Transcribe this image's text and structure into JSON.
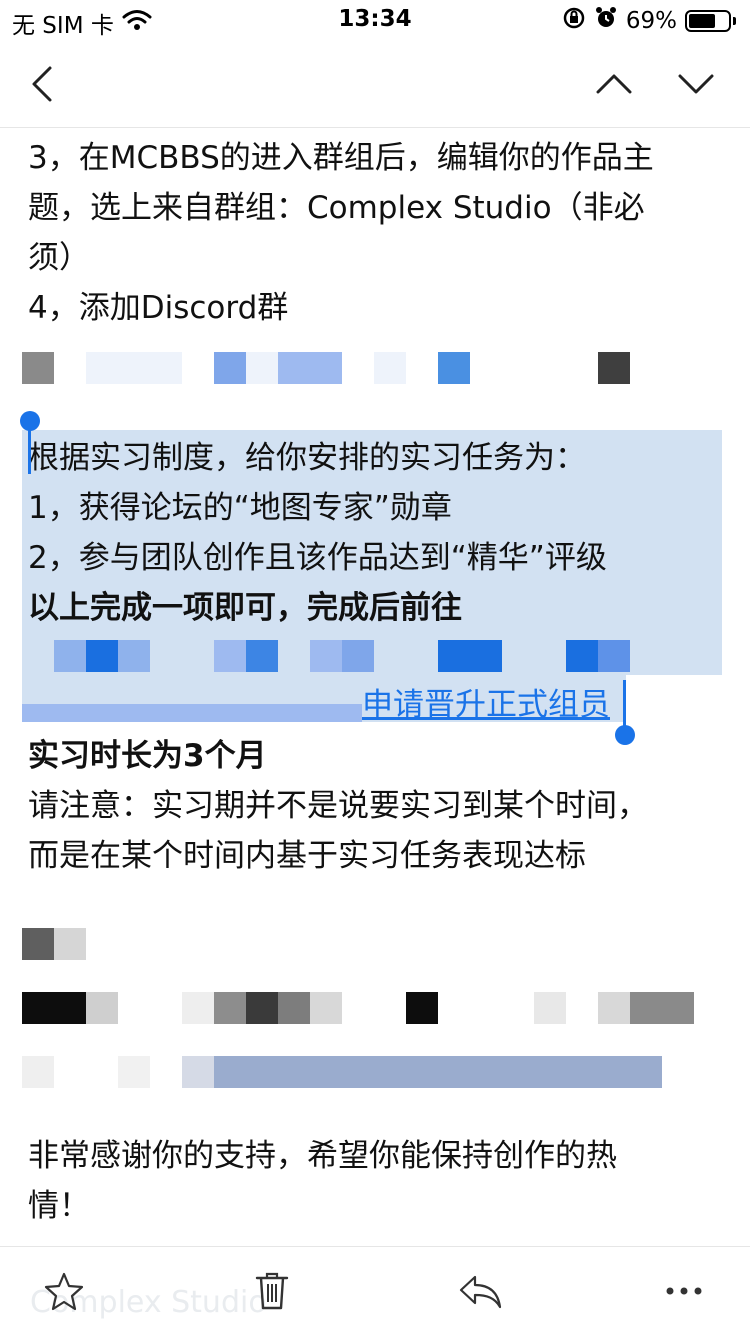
{
  "status_bar": {
    "carrier": "无 SIM 卡",
    "time": "13:34",
    "battery_percent": "69%",
    "battery_level": 0.69
  },
  "nav": {
    "icons": [
      "back-chevron-icon",
      "previous-mail-icon",
      "next-mail-icon"
    ]
  },
  "body": {
    "step3_line1": "3，在MCBBS的进入群组后，编辑你的作品主",
    "step3_line2": "题，选上来自群组：Complex Studio（非必",
    "step3_line3": "须）",
    "step4": "4，添加Discord群",
    "task_intro": "根据实习制度，给你安排的实习任务为：",
    "task1": "1，获得论坛的“地图专家”勋章",
    "task2": "2，参与团队创作且该作品达到“精华”评级",
    "task_note": "以上完成一项即可，完成后前往",
    "apply_link": "申请晋升正式组员",
    "duration": "实习时长为3个月",
    "notice_line1": "请注意：实习期并不是说要实习到某个时间，",
    "notice_line2": "而是在某个时间内基于实习任务表现达标",
    "thanks_line1": "非常感谢你的支持，希望你能保持创作的热",
    "thanks_line2": "情！"
  },
  "toolbar": {
    "icons": [
      "star-icon",
      "trash-icon",
      "reply-icon",
      "more-icon"
    ],
    "watermark": "Complex Studio"
  },
  "colors": {
    "accent": "#1a73e8",
    "selection": "#d2e1f2"
  }
}
